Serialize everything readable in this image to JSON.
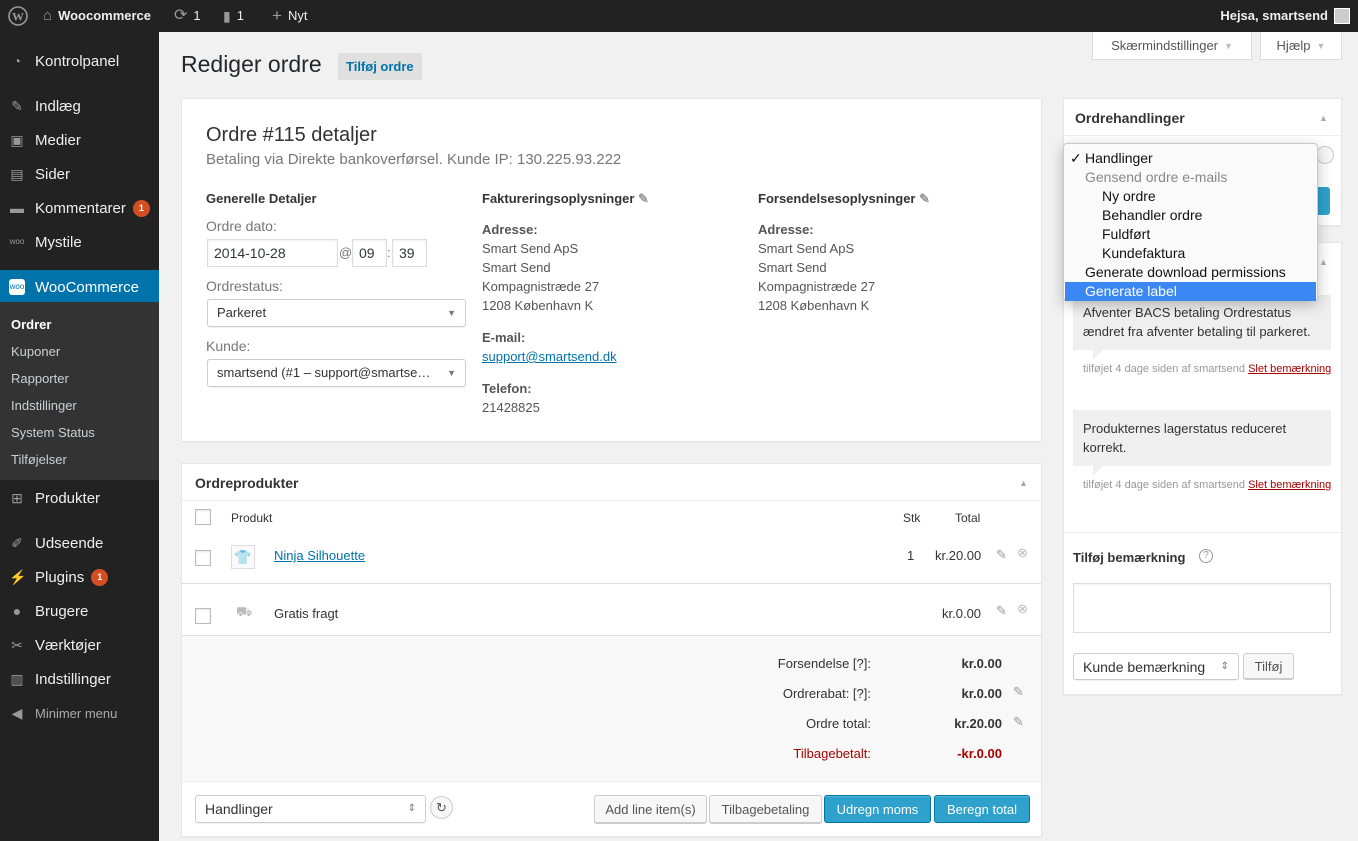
{
  "adminbar": {
    "site_name": "Woocommerce",
    "updates_count": "1",
    "comments_count": "1",
    "new_label": "Nyt",
    "greeting": "Hejsa, smartsend"
  },
  "sidebar": {
    "items": [
      {
        "label": "Kontrolpanel",
        "icon": "dashboard-icon"
      },
      {
        "label": "Indlæg",
        "icon": "pin-icon"
      },
      {
        "label": "Medier",
        "icon": "media-icon"
      },
      {
        "label": "Sider",
        "icon": "pages-icon"
      },
      {
        "label": "Kommentarer",
        "icon": "comments-icon",
        "badge": "1"
      },
      {
        "label": "Mystile",
        "icon": "woo-icon"
      },
      {
        "label": "WooCommerce",
        "icon": "woo-icon"
      },
      {
        "label": "Produkter",
        "icon": "cart-icon"
      },
      {
        "label": "Udseende",
        "icon": "brush-icon"
      },
      {
        "label": "Plugins",
        "icon": "plugin-icon",
        "badge": "1"
      },
      {
        "label": "Brugere",
        "icon": "users-icon"
      },
      {
        "label": "Værktøjer",
        "icon": "tools-icon"
      },
      {
        "label": "Indstillinger",
        "icon": "settings-icon"
      }
    ],
    "submenu": [
      "Ordrer",
      "Kuponer",
      "Rapporter",
      "Indstillinger",
      "System Status",
      "Tilføjelser"
    ],
    "collapse_label": "Minimer menu"
  },
  "screen_options_label": "Skærmindstillinger",
  "help_label": "Hjælp",
  "page": {
    "title": "Rediger ordre",
    "add_label": "Tilføj ordre"
  },
  "order": {
    "heading": "Ordre #115 detaljer",
    "subheading": "Betaling via Direkte bankoverførsel. Kunde IP: 130.225.93.222",
    "general_title": "Generelle Detaljer",
    "date_label": "Ordre dato:",
    "date": "2014-10-28",
    "at": "@",
    "hour": "09",
    "colon": ":",
    "minute": "39",
    "status_label": "Ordrestatus:",
    "status": "Parkeret",
    "customer_label": "Kunde:",
    "customer": "smartsend (#1 – support@smartse…",
    "billing_title": "Faktureringsoplysninger",
    "shipping_title": "Forsendelsesoplysninger",
    "address_label": "Adresse:",
    "billing_address": [
      "Smart Send ApS",
      "Smart Send",
      "Kompagnistræde 27",
      "1208 København K"
    ],
    "shipping_address": [
      "Smart Send ApS",
      "Smart Send",
      "Kompagnistræde 27",
      "1208 København K"
    ],
    "email_label": "E-mail:",
    "email": "support@smartsend.dk",
    "phone_label": "Telefon:",
    "phone": "21428825"
  },
  "items": {
    "title": "Ordreprodukter",
    "col_product": "Produkt",
    "col_qty": "Stk",
    "col_total": "Total",
    "product_name": "Ninja Silhouette",
    "product_qty": "1",
    "product_total": "kr.20.00",
    "shipping_name": "Gratis fragt",
    "shipping_total": "kr.0.00",
    "totals": [
      {
        "label": "Forsendelse [?]:",
        "value": "kr.0.00"
      },
      {
        "label": "Ordrerabat: [?]:",
        "value": "kr.0.00"
      },
      {
        "label": "Ordre total:",
        "value": "kr.20.00"
      },
      {
        "label": "Tilbagebetalt:",
        "value": "-kr.0.00"
      }
    ],
    "bulk_action": "Handlinger",
    "btn_add_line": "Add line item(s)",
    "btn_refund": "Tilbagebetaling",
    "btn_calc_tax": "Udregn moms",
    "btn_calc_total": "Beregn total"
  },
  "actions": {
    "title": "Ordrehandlinger",
    "options": [
      {
        "label": "Handlinger",
        "checked": "✓"
      },
      {
        "label": "Gensend ordre e-mails"
      },
      {
        "label": "Ny ordre"
      },
      {
        "label": "Behandler ordre"
      },
      {
        "label": "Fuldført"
      },
      {
        "label": "Kundefaktura"
      },
      {
        "label": "Generate download permissions"
      },
      {
        "label": "Generate label"
      }
    ]
  },
  "notes": {
    "note1": "Afventer BACS betaling Ordrestatus ændret fra afventer betaling til parkeret.",
    "note1_meta": "tilføjet 4 dage siden af smartsend",
    "note2": "Produkternes lagerstatus reduceret korrekt.",
    "note2_meta": "tilføjet 4 dage siden af smartsend",
    "delete_label": "Slet bemærkning",
    "add_title": "Tilføj bemærkning",
    "note_type": "Kunde bemærkning",
    "add_button": "Tilføj"
  },
  "colors": {
    "accent": "#0073aa",
    "primary_button": "#2ea2cc",
    "badge": "#d54e21",
    "refund_red": "#a00"
  }
}
